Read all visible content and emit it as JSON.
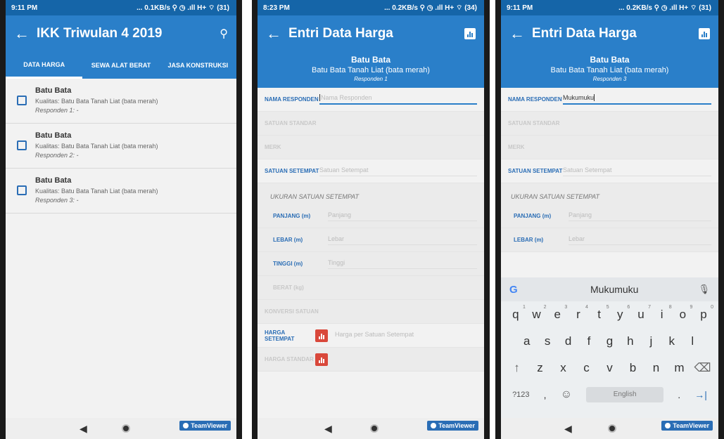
{
  "screen1": {
    "status": {
      "time": "9:11 PM",
      "info": "... 0.1KB/s ⚲ ◷ .ıll H+ ⌔ (31)"
    },
    "title": "IKK Triwulan 4 2019",
    "tabs": [
      {
        "label": "DATA HARGA"
      },
      {
        "label": "SEWA ALAT BERAT"
      },
      {
        "label": "JASA KONSTRUKSI"
      }
    ],
    "items": [
      {
        "title": "Batu Bata",
        "quality": "Kualitas: Batu Bata Tanah Liat (bata merah)",
        "resp": "Responden 1: -"
      },
      {
        "title": "Batu Bata",
        "quality": "Kualitas: Batu Bata Tanah Liat (bata merah)",
        "resp": "Responden 2: -"
      },
      {
        "title": "Batu Bata",
        "quality": "Kualitas: Batu Bata Tanah Liat (bata merah)",
        "resp": "Responden 3: -"
      }
    ],
    "teamviewer": "TeamViewer"
  },
  "screen2": {
    "status": {
      "time": "8:23 PM",
      "info": "... 0.2KB/s ⚲ ◷ .ıll H+ ⌔ (34)"
    },
    "title": "Entri Data Harga",
    "header": {
      "title": "Batu Bata",
      "sub": "Batu Bata Tanah Liat (bata merah)",
      "resp": "Responden 1"
    },
    "fields": {
      "nama": {
        "label": "NAMA RESPONDEN",
        "placeholder": "Nama Responden"
      },
      "satuan_standar": {
        "label": "SATUAN STANDAR"
      },
      "merk": {
        "label": "MERK"
      },
      "satuan_setempat": {
        "label": "SATUAN SETEMPAT",
        "placeholder": "Satuan Setempat"
      },
      "ukuran": {
        "label": "UKURAN SATUAN SETEMPAT"
      },
      "panjang": {
        "label": "PANJANG (m)",
        "placeholder": "Panjang"
      },
      "lebar": {
        "label": "LEBAR (m)",
        "placeholder": "Lebar"
      },
      "tinggi": {
        "label": "TINGGI (m)",
        "placeholder": "Tinggi"
      },
      "berat": {
        "label": "BERAT (kg)"
      },
      "konversi": {
        "label": "KONVERSI SATUAN"
      },
      "harga_setempat": {
        "label": "HARGA SETEMPAT",
        "placeholder": "Harga per Satuan Setempat"
      },
      "harga_standar": {
        "label": "HARGA STANDAR"
      }
    },
    "teamviewer": "TeamViewer"
  },
  "screen3": {
    "status": {
      "time": "9:11 PM",
      "info": "... 0.2KB/s ⚲ ◷ .ıll H+ ⌔ (31)"
    },
    "title": "Entri Data Harga",
    "header": {
      "title": "Batu Bata",
      "sub": "Batu Bata Tanah Liat (bata merah)",
      "resp": "Responden 3"
    },
    "fields": {
      "nama": {
        "label": "NAMA RESPONDEN",
        "value": "Mukumuku"
      },
      "satuan_standar": {
        "label": "SATUAN STANDAR"
      },
      "merk": {
        "label": "MERK"
      },
      "satuan_setempat": {
        "label": "SATUAN SETEMPAT",
        "placeholder": "Satuan Setempat"
      },
      "ukuran": {
        "label": "UKURAN SATUAN SETEMPAT"
      },
      "panjang": {
        "label": "PANJANG (m)",
        "placeholder": "Panjang"
      },
      "lebar": {
        "label": "LEBAR (m)",
        "placeholder": "Lebar"
      }
    },
    "keyboard": {
      "suggestion": "Mukumuku",
      "row1": [
        "q",
        "w",
        "e",
        "r",
        "t",
        "y",
        "u",
        "i",
        "o",
        "p"
      ],
      "row1_hints": [
        "1",
        "2",
        "3",
        "4",
        "5",
        "6",
        "7",
        "8",
        "9",
        "0"
      ],
      "row2": [
        "a",
        "s",
        "d",
        "f",
        "g",
        "h",
        "j",
        "k",
        "l"
      ],
      "row3": [
        "↑",
        "z",
        "x",
        "c",
        "v",
        "b",
        "n",
        "m",
        "⌫"
      ],
      "symbols": "?123",
      "comma": ",",
      "emoji": "☺",
      "space": "English",
      "period": ".",
      "enter": "→|"
    },
    "teamviewer": "TeamViewer"
  },
  "colors": {
    "primary": "#2a7fc9",
    "statusbar": "#1565a8",
    "accent_red": "#d9483b"
  }
}
